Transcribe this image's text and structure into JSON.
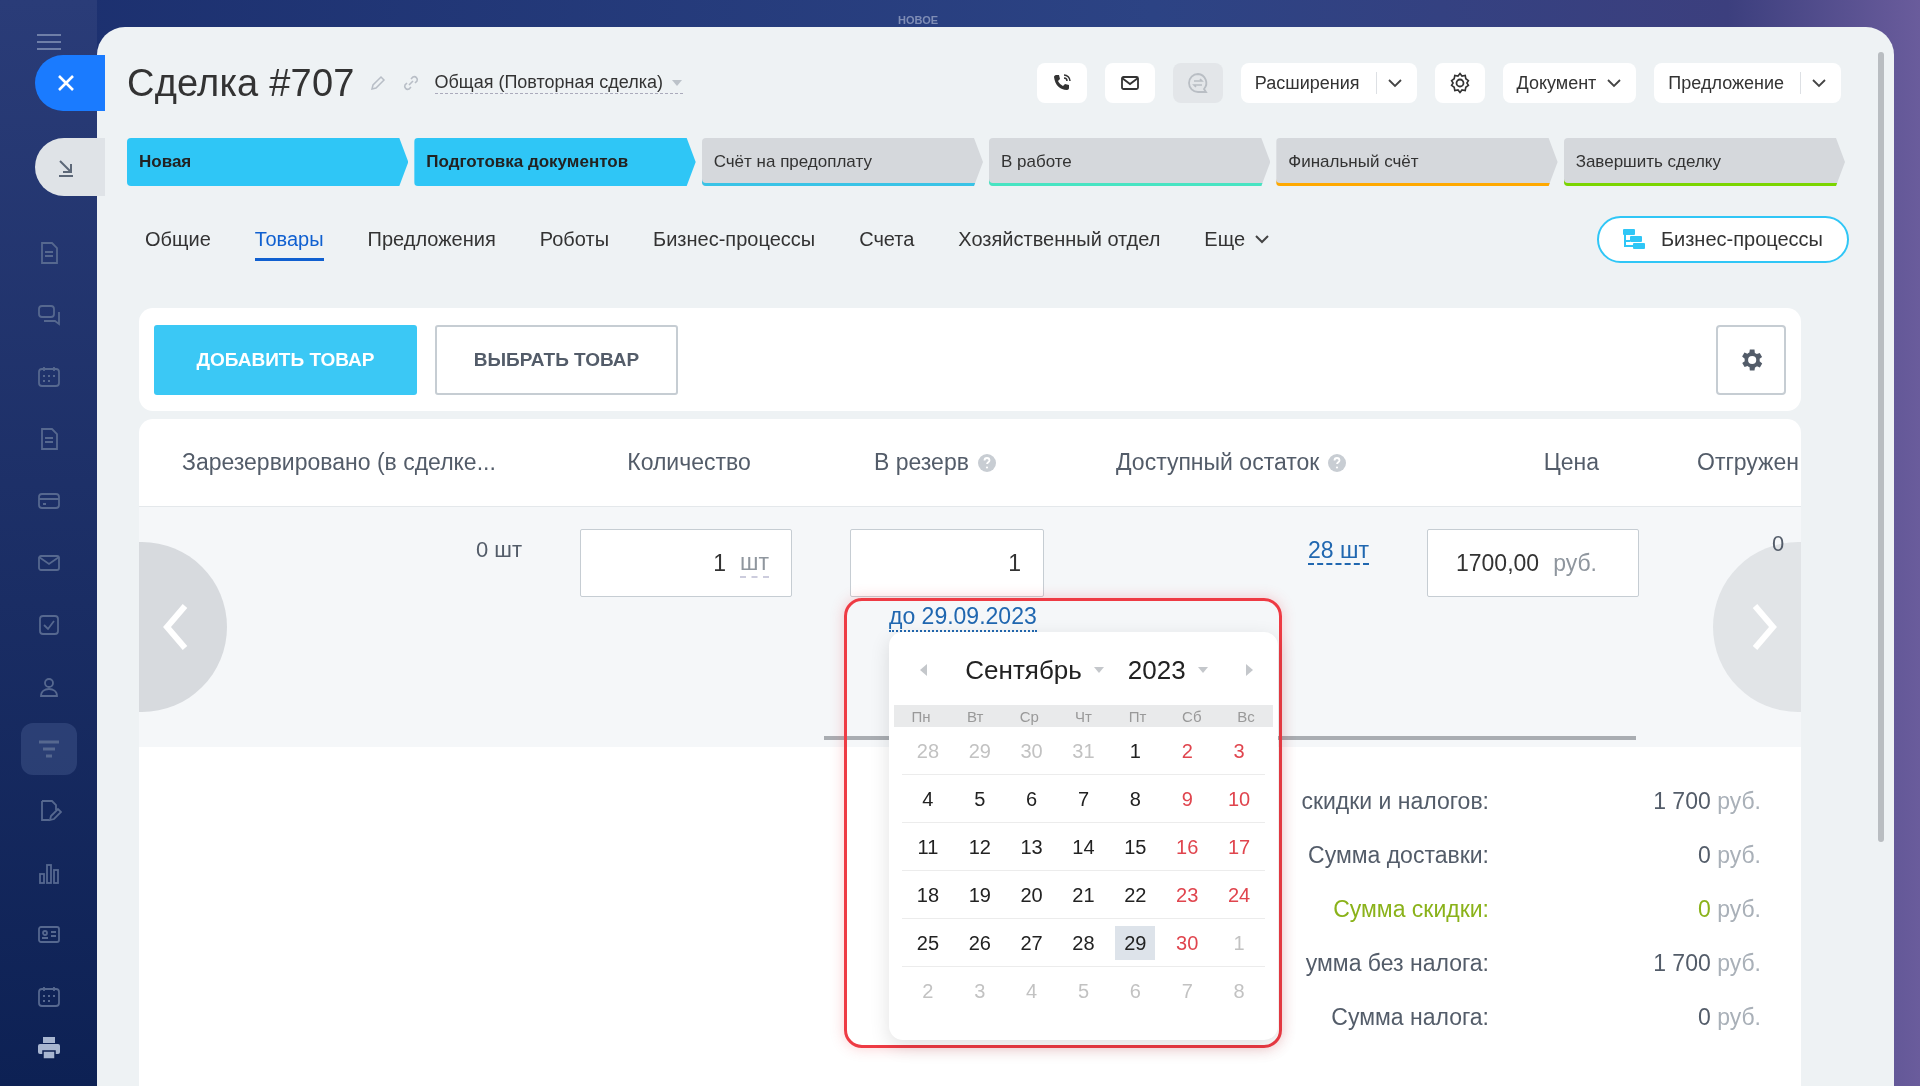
{
  "background_label": "НОВОЕ",
  "deal": {
    "title": "Сделка #707",
    "category": "Общая (Повторная сделка)"
  },
  "toolbar": [
    {
      "kind": "icon",
      "disabled": false
    },
    {
      "kind": "icon",
      "disabled": false
    },
    {
      "kind": "icon",
      "disabled": true
    },
    {
      "kind": "split",
      "label": "Расширения",
      "disabled": false
    },
    {
      "kind": "icon",
      "disabled": false
    },
    {
      "kind": "dropdown",
      "label": "Документ",
      "disabled": false
    },
    {
      "kind": "split",
      "label": "Предложение",
      "disabled": false
    }
  ],
  "stages": [
    {
      "label": "Новая",
      "passed": true,
      "color": "#2fc6f6"
    },
    {
      "label": "Подготовка документов",
      "passed": true,
      "color": "#2fc6f6"
    },
    {
      "label": "Счёт на предоплату",
      "passed": false,
      "color": "#39c3e6"
    },
    {
      "label": "В работе",
      "passed": false,
      "color": "#47e4c2"
    },
    {
      "label": "Финальный счёт",
      "passed": false,
      "color": "#ffa900"
    },
    {
      "label": "Завершить сделку",
      "passed": false,
      "color": "#7bd500"
    }
  ],
  "tabs": [
    {
      "label": "Общие",
      "selected": false,
      "dropdown": false
    },
    {
      "label": "Товары",
      "selected": true,
      "dropdown": false
    },
    {
      "label": "Предложения",
      "selected": false,
      "dropdown": false
    },
    {
      "label": "Роботы",
      "selected": false,
      "dropdown": false
    },
    {
      "label": "Бизнес-процессы",
      "selected": false,
      "dropdown": false
    },
    {
      "label": "Счета",
      "selected": false,
      "dropdown": false
    },
    {
      "label": "Хозяйственный отдел",
      "selected": false,
      "dropdown": false
    },
    {
      "label": "Еще",
      "selected": false,
      "dropdown": true
    }
  ],
  "process_button": {
    "label": "Бизнес-процессы"
  },
  "product_actions": {
    "add": "ДОБАВИТЬ ТОВАР",
    "select": "ВЫБРАТЬ ТОВАР"
  },
  "table": {
    "columns": [
      {
        "label": "Зарезервировано (в сделке...",
        "help": false
      },
      {
        "label": "Количество",
        "help": false
      },
      {
        "label": "В резерв",
        "help": true
      },
      {
        "label": "Доступный остаток",
        "help": true
      },
      {
        "label": "Цена",
        "help": false
      },
      {
        "label": "Отгружен",
        "help": false
      }
    ],
    "row": {
      "reserved": "0 шт",
      "quantity": "1",
      "quantity_unit": "шт",
      "reserve": "1",
      "available": "28 шт",
      "price": "1700,00",
      "price_unit": "руб.",
      "shipped": "0"
    }
  },
  "reserve_date": "до 29.09.2023",
  "calendar": {
    "month": "Сентябрь",
    "year": "2023",
    "weekdays": [
      "Пн",
      "Вт",
      "Ср",
      "Чт",
      "Пт",
      "Сб",
      "Вс"
    ],
    "weeks": [
      [
        {
          "day": "28",
          "kind": "other",
          "selected": false
        },
        {
          "day": "29",
          "kind": "other",
          "selected": false
        },
        {
          "day": "30",
          "kind": "other",
          "selected": false
        },
        {
          "day": "31",
          "kind": "other",
          "selected": false
        },
        {
          "day": "1",
          "kind": "weekday",
          "selected": false
        },
        {
          "day": "2",
          "kind": "weekend",
          "selected": false
        },
        {
          "day": "3",
          "kind": "weekend",
          "selected": false
        }
      ],
      [
        {
          "day": "4",
          "kind": "weekday",
          "selected": false
        },
        {
          "day": "5",
          "kind": "weekday",
          "selected": false
        },
        {
          "day": "6",
          "kind": "weekday",
          "selected": false
        },
        {
          "day": "7",
          "kind": "weekday",
          "selected": false
        },
        {
          "day": "8",
          "kind": "weekday",
          "selected": false
        },
        {
          "day": "9",
          "kind": "weekend",
          "selected": false
        },
        {
          "day": "10",
          "kind": "weekend",
          "selected": false
        }
      ],
      [
        {
          "day": "11",
          "kind": "weekday",
          "selected": false
        },
        {
          "day": "12",
          "kind": "weekday",
          "selected": false
        },
        {
          "day": "13",
          "kind": "weekday",
          "selected": false
        },
        {
          "day": "14",
          "kind": "weekday",
          "selected": false
        },
        {
          "day": "15",
          "kind": "weekday",
          "selected": false
        },
        {
          "day": "16",
          "kind": "weekend",
          "selected": false
        },
        {
          "day": "17",
          "kind": "weekend",
          "selected": false
        }
      ],
      [
        {
          "day": "18",
          "kind": "weekday",
          "selected": false
        },
        {
          "day": "19",
          "kind": "weekday",
          "selected": false
        },
        {
          "day": "20",
          "kind": "weekday",
          "selected": false
        },
        {
          "day": "21",
          "kind": "weekday",
          "selected": false
        },
        {
          "day": "22",
          "kind": "weekday",
          "selected": false
        },
        {
          "day": "23",
          "kind": "weekend",
          "selected": false
        },
        {
          "day": "24",
          "kind": "weekend",
          "selected": false
        }
      ],
      [
        {
          "day": "25",
          "kind": "weekday",
          "selected": false
        },
        {
          "day": "26",
          "kind": "weekday",
          "selected": false
        },
        {
          "day": "27",
          "kind": "weekday",
          "selected": false
        },
        {
          "day": "28",
          "kind": "weekday",
          "selected": false
        },
        {
          "day": "29",
          "kind": "weekday",
          "selected": true
        },
        {
          "day": "30",
          "kind": "weekend",
          "selected": false
        },
        {
          "day": "1",
          "kind": "other",
          "selected": false
        }
      ],
      [
        {
          "day": "2",
          "kind": "other",
          "selected": false
        },
        {
          "day": "3",
          "kind": "other",
          "selected": false
        },
        {
          "day": "4",
          "kind": "other",
          "selected": false
        },
        {
          "day": "5",
          "kind": "other",
          "selected": false
        },
        {
          "day": "6",
          "kind": "other",
          "selected": false
        },
        {
          "day": "7",
          "kind": "other",
          "selected": false
        },
        {
          "day": "8",
          "kind": "other",
          "selected": false
        }
      ]
    ]
  },
  "totals": [
    {
      "label": "скидки и налогов:",
      "value": "1 700",
      "unit": "руб.",
      "kind": "plain"
    },
    {
      "label": "Сумма доставки:",
      "value": "0",
      "unit": "руб.",
      "kind": "plain"
    },
    {
      "label": "Сумма скидки:",
      "value": "0",
      "unit": "руб.",
      "kind": "discount"
    },
    {
      "label": "умма без налога:",
      "value": "1 700",
      "unit": "руб.",
      "kind": "plain"
    },
    {
      "label": "Сумма налога:",
      "value": "0",
      "unit": "руб.",
      "kind": "plain"
    }
  ]
}
